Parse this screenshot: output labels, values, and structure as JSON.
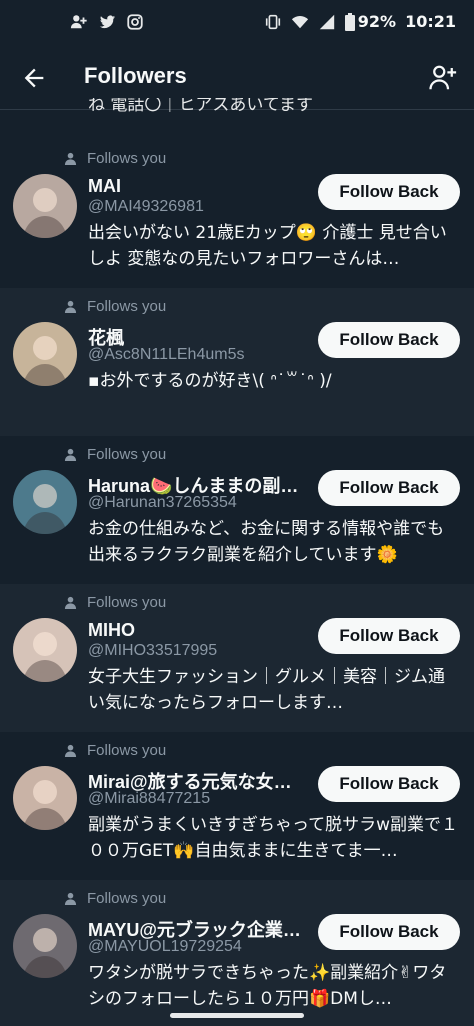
{
  "status_bar": {
    "battery": "92%",
    "time": "10:21"
  },
  "header": {
    "title": "Followers"
  },
  "cut_line": "ね 電話〇｜ヒアスあいてます",
  "follows_you_label": "Follows you",
  "follow_back_label": "Follow Back",
  "followers": [
    {
      "name": "MAI",
      "handle": "@MAI49326981",
      "bio": "出会いがない 21歳Eカップ🙄 介護士 見せ合いしよ 変態なの見たいフォロワーさんは…",
      "avatar_color": "#b8a8a0"
    },
    {
      "name": "花楓",
      "handle": "@Asc8N11LEh4um5s",
      "bio": "▪お外でするのが好き\\( ᐢ˙꒳˙ᐢ )/",
      "avatar_color": "#c7b49a"
    },
    {
      "name": "Haruna🍉しんままの副…",
      "handle": "@Harunan37265354",
      "bio": "お金の仕組みなど、お金に関する情報や誰でも出来るラクラク副業を紹介しています🌼",
      "avatar_color": "#4d7a8c"
    },
    {
      "name": "MIHO",
      "handle": "@MIHO33517995",
      "bio": "女子大生ファッション｜グルメ｜美容｜ジム通い気になったらフォローします…",
      "avatar_color": "#d6c3b8"
    },
    {
      "name": "Mirai@旅する元気な女…",
      "handle": "@Mirai88477215",
      "bio": "副業がうまくいきすぎちゃって脱サラw副業で１００万GET🙌自由気ままに生きてま一…",
      "avatar_color": "#c9b3a6"
    },
    {
      "name": "MAYU@元ブラック企業…",
      "handle": "@MAYUOL19729254",
      "bio": "ワタシが脱サラできちゃった✨副業紹介✌ワタシのフォローしたら１０万円🎁DMし…",
      "avatar_color": "#6e6a70"
    }
  ]
}
